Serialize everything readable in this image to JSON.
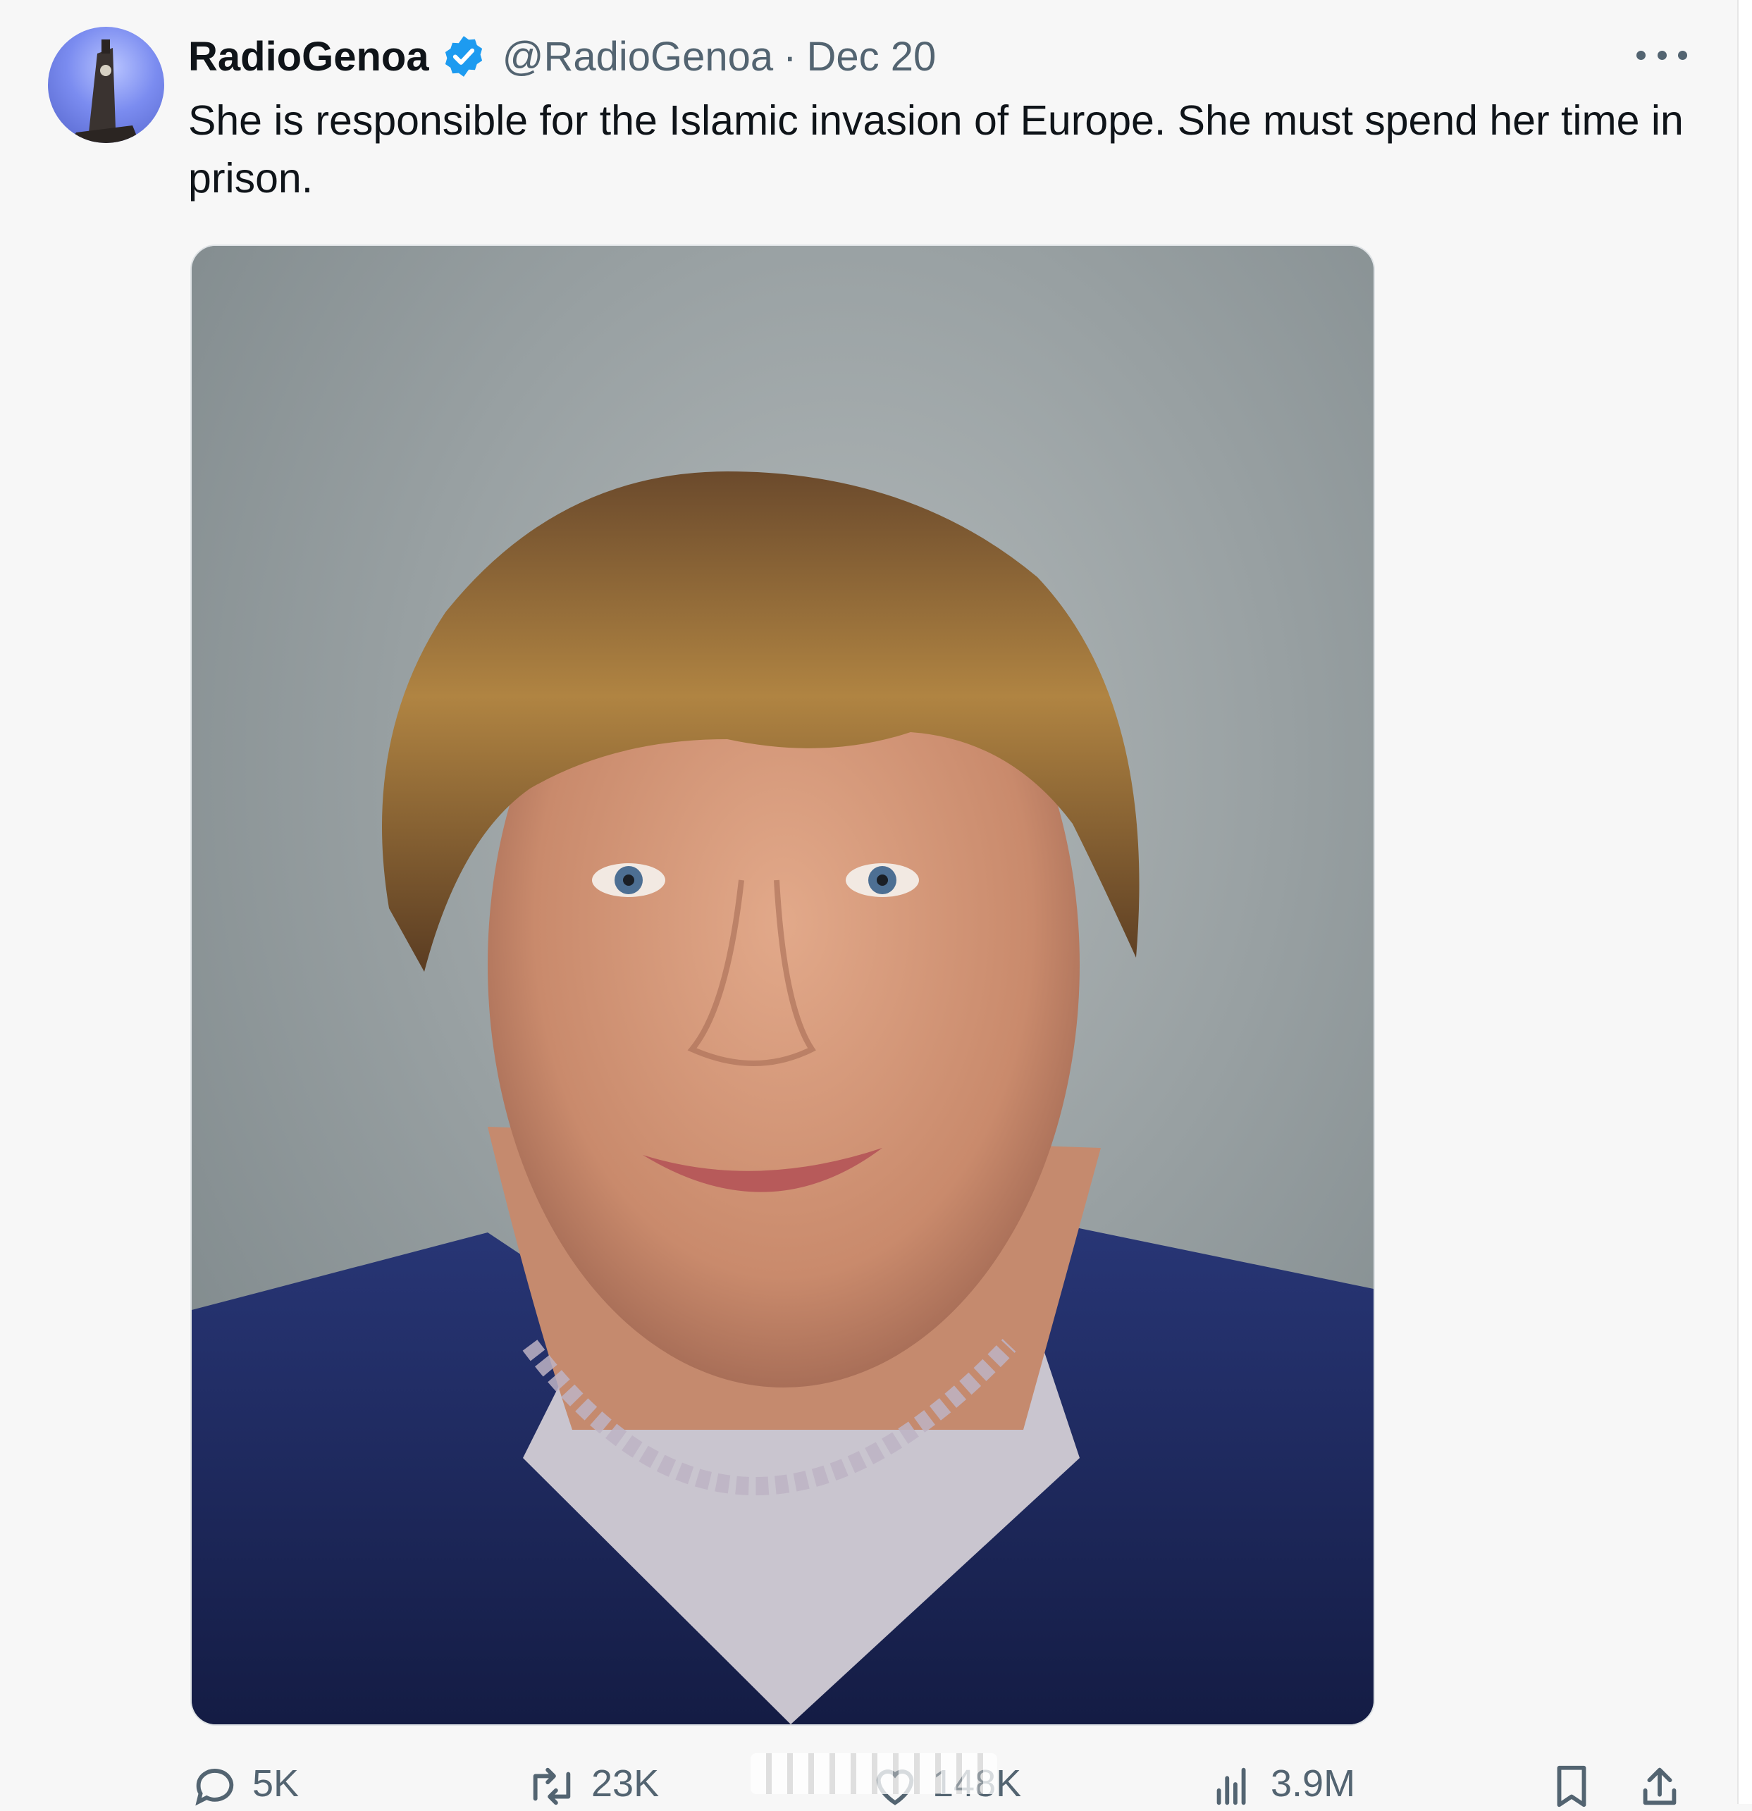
{
  "tweet": {
    "display_name": "RadioGenoa",
    "handle": "@RadioGenoa",
    "separator": "·",
    "date": "Dec 20",
    "verified": true,
    "text": "She is responsible for the Islamic invasion of Europe. She must spend her time in prison.",
    "media_alt": "Portrait photo of a smiling woman with short blonde hair, wearing a dark blue jacket and a necklace"
  },
  "actions": {
    "replies": "5K",
    "reposts": "23K",
    "likes": "148K",
    "views": "3.9M"
  },
  "colors": {
    "background": "#f7f7f7",
    "text_primary": "#0f1419",
    "text_secondary": "#536471",
    "verified_blue": "#1d9bf0"
  },
  "icons": {
    "more": "more-dots-icon",
    "verified": "verified-badge-icon",
    "reply": "reply-icon",
    "repost": "repost-icon",
    "like": "like-icon",
    "views": "views-icon",
    "bookmark": "bookmark-icon",
    "share": "share-icon"
  }
}
